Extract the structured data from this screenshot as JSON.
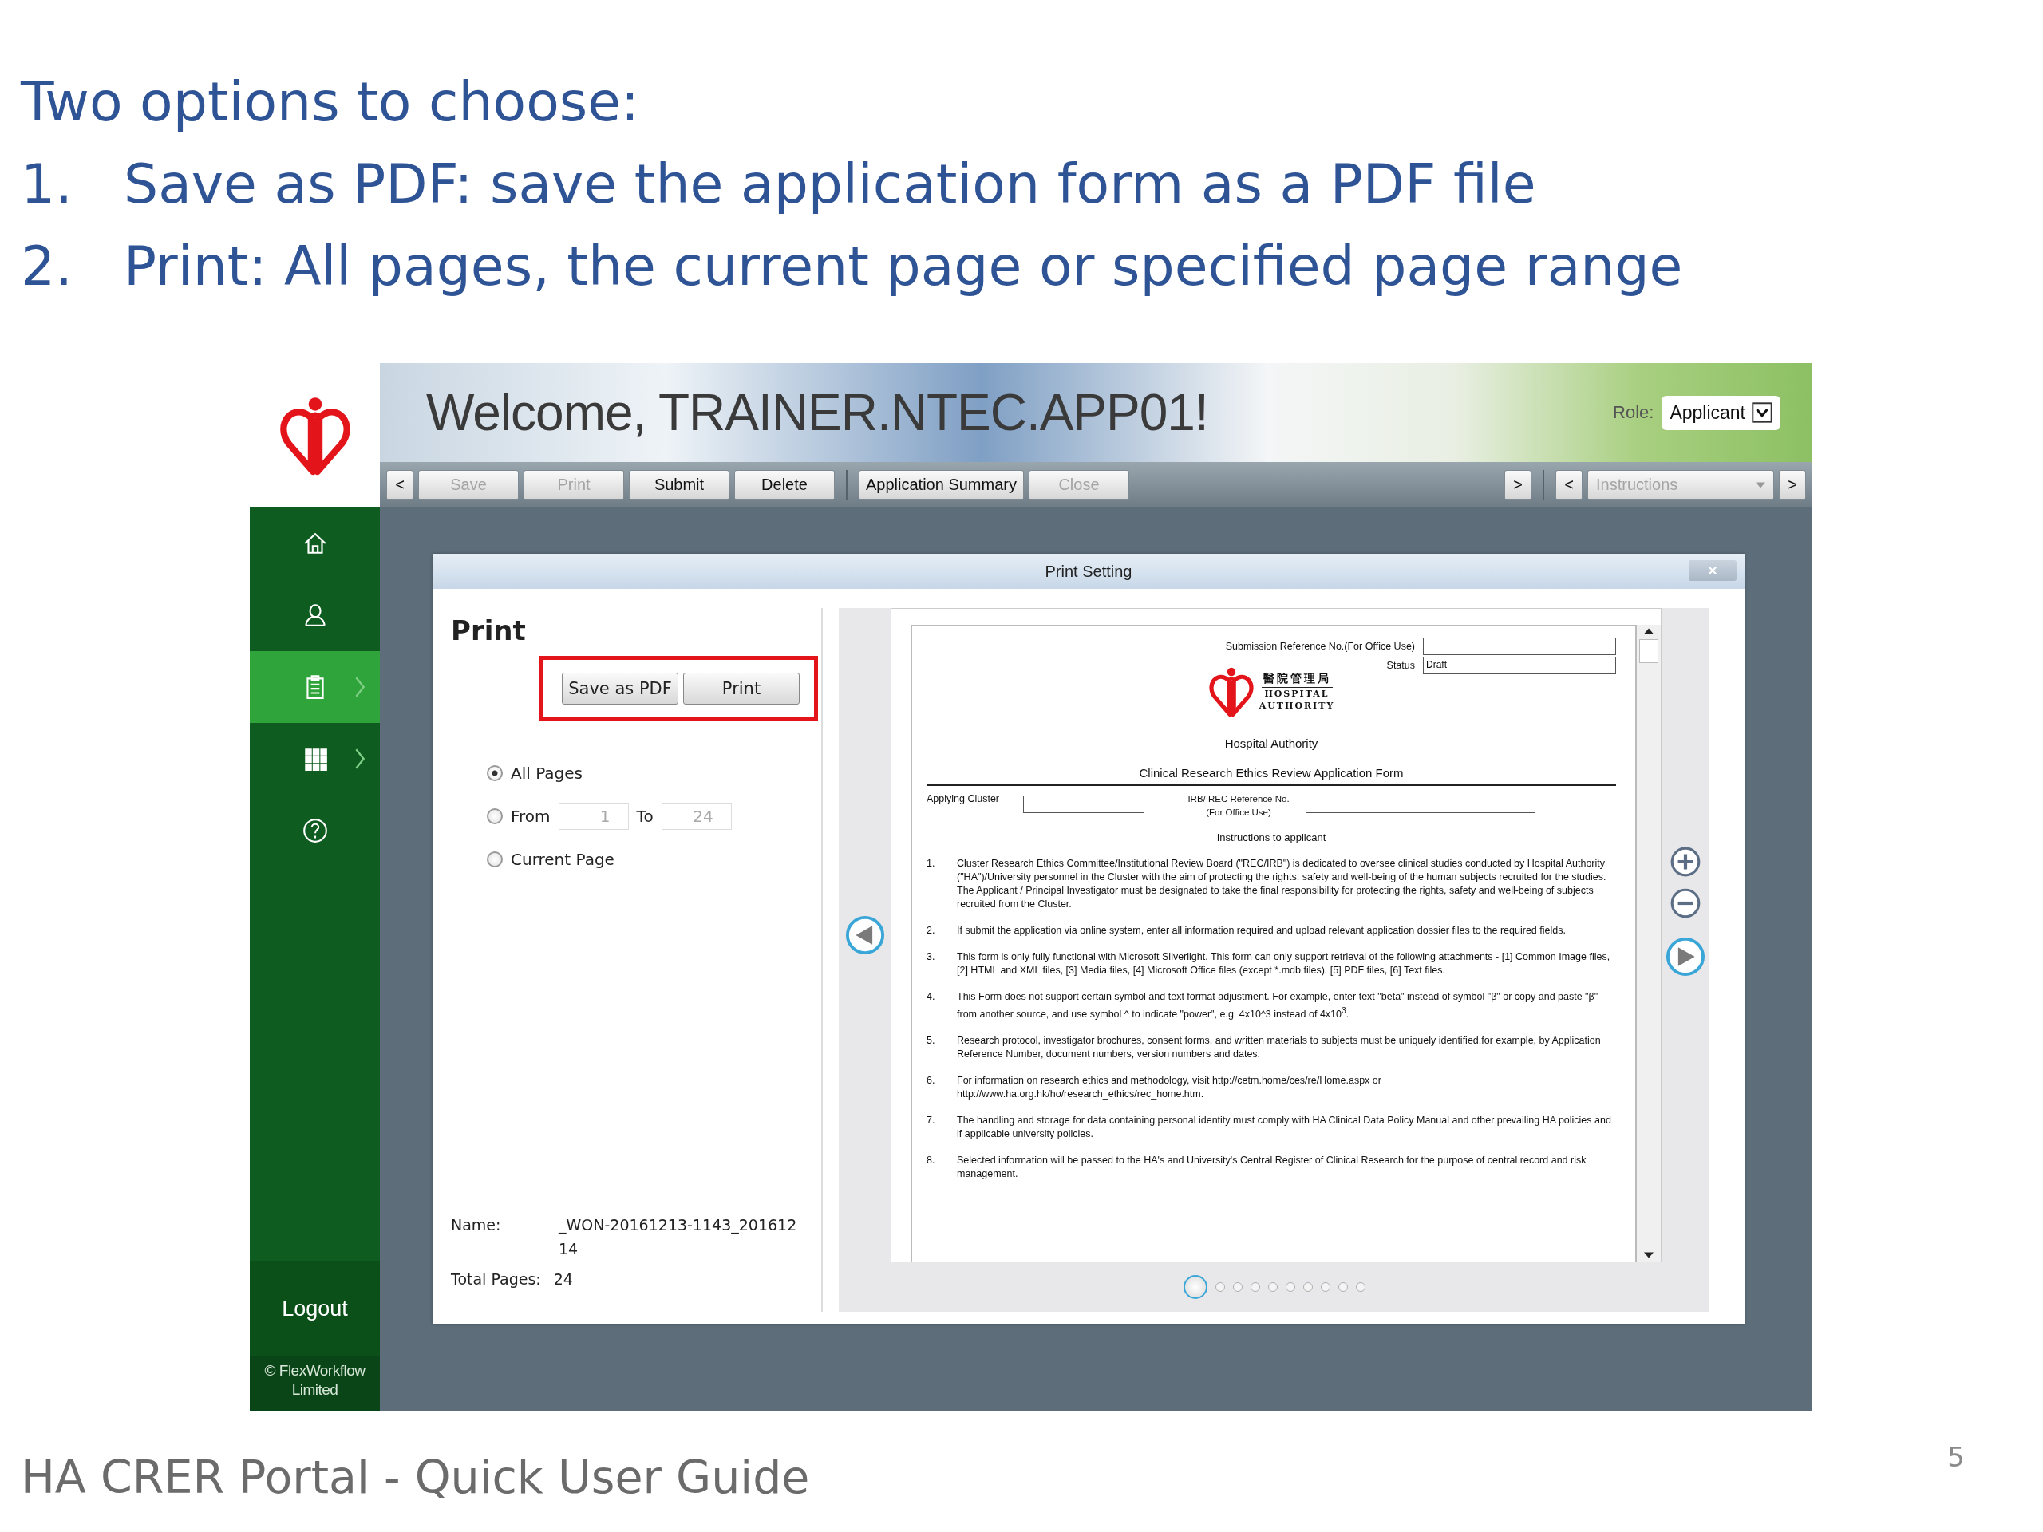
{
  "slide": {
    "heading": "Two options to choose:",
    "points": [
      {
        "number": "1.",
        "text": "Save as PDF: save the application form as a PDF file"
      },
      {
        "number": "2.",
        "text": "Print: All pages, the current page or specified page range"
      }
    ],
    "footer": "HA CRER Portal - Quick User Guide",
    "page_number": "5"
  },
  "app": {
    "welcome": "Welcome, TRAINER.NTEC.APP01!",
    "role_label": "Role:",
    "role_value": "Applicant",
    "toolbar": {
      "left": [
        {
          "kind": "arrow",
          "label": "<",
          "disabled": false
        },
        {
          "kind": "button",
          "label": "Save",
          "disabled": true
        },
        {
          "kind": "button",
          "label": "Print",
          "disabled": true
        },
        {
          "kind": "button",
          "label": "Submit",
          "disabled": false
        },
        {
          "kind": "button",
          "label": "Delete",
          "disabled": false
        },
        {
          "kind": "divider"
        },
        {
          "kind": "button",
          "label": "Application Summary",
          "disabled": false
        },
        {
          "kind": "button",
          "label": "Close",
          "disabled": true
        }
      ],
      "right": [
        {
          "kind": "arrow",
          "label": ">",
          "disabled": false
        },
        {
          "kind": "divider"
        },
        {
          "kind": "arrow",
          "label": "<",
          "disabled": false
        },
        {
          "kind": "dropdown",
          "label": "Instructions",
          "disabled": true
        },
        {
          "kind": "arrow",
          "label": ">",
          "disabled": false
        }
      ]
    },
    "sidebar": {
      "items": [
        {
          "selected": false,
          "expandable": false
        },
        {
          "selected": false,
          "expandable": false
        },
        {
          "selected": true,
          "expandable": true
        },
        {
          "selected": false,
          "expandable": true
        },
        {
          "selected": false,
          "expandable": false
        }
      ],
      "logout": "Logout",
      "copyright": "© FlexWorkflow Limited"
    },
    "dialog": {
      "title": "Print Setting",
      "heading": "Print",
      "actions_highlighted": true,
      "actions": [
        {
          "label": "Save as PDF"
        },
        {
          "label": "Print"
        }
      ],
      "range_options": [
        {
          "kind": "all",
          "label": "All Pages",
          "selected": true
        },
        {
          "kind": "range",
          "label": "From",
          "selected": false,
          "from": "1",
          "to_label": "To",
          "to": "24"
        },
        {
          "kind": "current",
          "label": "Current Page",
          "selected": false
        }
      ],
      "name_label": "Name:",
      "name_value": "_WON-20161213-1143_20161214",
      "total_label": "Total Pages:",
      "total_value": "24",
      "preview": {
        "ref_label": "Submission Reference No.(For Office Use)",
        "status_label": "Status",
        "status_value": "Draft",
        "logo_chinese": "醫院管理局",
        "logo_line_1": "HOSPITAL",
        "logo_line_2": "AUTHORITY",
        "organisation": "Hospital Authority",
        "form_title": "Clinical Research Ethics Review Application Form",
        "cluster_label": "Applying Cluster",
        "irb_label": "IRB/ REC Reference No. (For Office Use)",
        "instructions_title": "Instructions to applicant",
        "instructions": [
          {
            "number": "1.",
            "text": "Cluster Research Ethics Committee/Institutional Review Board (\"REC/IRB\") is dedicated to oversee clinical studies conducted by Hospital Authority (\"HA\")/University personnel in the Cluster with the aim of protecting the rights, safety and well-being of the human subjects recruited for the studies. The Applicant / Principal Investigator must be designated to take the final responsibility for protecting the rights, safety and well-being of subjects recruited from the Cluster."
          },
          {
            "number": "2.",
            "text": "If submit the application via online system, enter all information required and upload relevant application dossier files to the required fields."
          },
          {
            "number": "3.",
            "text": "This form is only fully functional with Microsoft Silverlight. This form can only support retrieval of the following attachments - [1] Common Image files, [2] HTML and XML files, [3] Media files, [4] Microsoft Office files (except *.mdb files), [5] PDF files, [6] Text files."
          },
          {
            "number": "4.",
            "text": "This Form does not support certain symbol and text format adjustment. For example, enter text \"beta\" instead of symbol \"β\" or copy and paste \"β\" from another source, and use symbol ^ to indicate \"power\", e.g. 4x10^3 instead of 4x10$^{3}$."
          },
          {
            "number": "5.",
            "text": "Research protocol, investigator brochures, consent forms, and written materials to subjects must be uniquely identified,for example, by Application Reference Number, document numbers, version numbers and dates."
          },
          {
            "number": "6.",
            "text": "For information on research ethics and methodology, visit http://cetm.home/ces/re/Home.aspx or http://www.ha.org.hk/ho/research_ethics/rec_home.htm."
          },
          {
            "number": "7.",
            "text": "The handling and storage for data containing personal identity must comply with HA Clinical Data Policy Manual and other prevailing HA policies and if applicable university policies."
          },
          {
            "number": "8.",
            "text": "Selected information will be passed to the HA's and University's Central Register of Clinical Research for the purpose of central record and risk management."
          }
        ],
        "pages": [
          {
            "selected": true
          },
          {
            "selected": false
          },
          {
            "selected": false
          },
          {
            "selected": false
          },
          {
            "selected": false
          },
          {
            "selected": false
          },
          {
            "selected": false
          },
          {
            "selected": false
          },
          {
            "selected": false
          },
          {
            "selected": false
          }
        ]
      }
    }
  }
}
